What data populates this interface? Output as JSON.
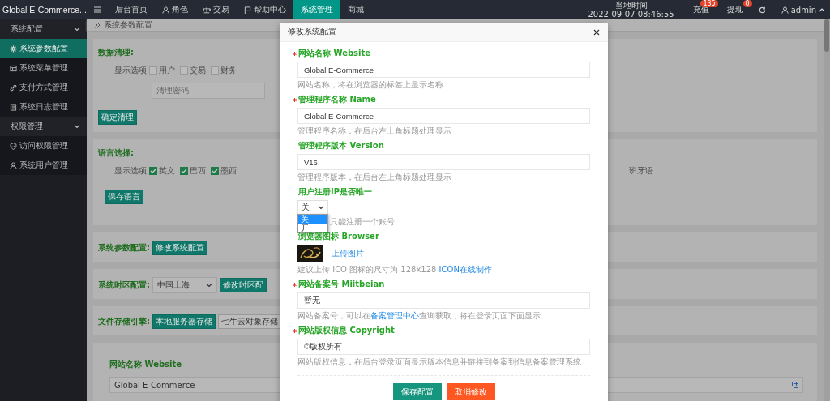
{
  "topbar": {
    "brand": "Global E-Commerce...",
    "nav": [
      {
        "label": "后台首页",
        "selected": false
      },
      {
        "label": "角色",
        "selected": false
      },
      {
        "label": "交易",
        "selected": false
      },
      {
        "label": "帮助中心",
        "selected": false
      },
      {
        "label": "系统管理",
        "selected": true
      },
      {
        "label": "商城",
        "selected": false
      }
    ],
    "time_label": "当地时间",
    "time": "2022-09-07 08:46:55",
    "actions": [
      {
        "label": "充值",
        "badge": "135"
      },
      {
        "label": "提现",
        "badge": "0"
      }
    ],
    "user": "admin"
  },
  "sidebar": [
    {
      "label": "系统配置",
      "expanded": true,
      "children": [
        {
          "label": "系统参数配置",
          "selected": true
        },
        {
          "label": "系统菜单管理",
          "selected": false
        },
        {
          "label": "支付方式管理",
          "selected": false
        },
        {
          "label": "系统日志管理",
          "selected": false
        }
      ]
    },
    {
      "label": "权限管理",
      "expanded": true,
      "children": [
        {
          "label": "访问权限管理",
          "selected": false
        },
        {
          "label": "系统用户管理",
          "selected": false
        }
      ]
    }
  ],
  "breadcrumb": "系统参数配置",
  "cleanup": {
    "title": "数据清理:",
    "options_label": "显示选项",
    "options": [
      {
        "label": "用户",
        "checked": false
      },
      {
        "label": "交易",
        "checked": false
      },
      {
        "label": "财务",
        "checked": false
      }
    ],
    "password_placeholder": "清理密码",
    "button": "确定清理"
  },
  "language": {
    "title": "语言选择:",
    "options_label": "显示选项",
    "options": [
      {
        "label": "英文",
        "checked": true
      },
      {
        "label": "巴西",
        "checked": true
      },
      {
        "label": "墨西",
        "checked": true
      }
    ],
    "partial_option": "班牙语",
    "button": "保存语言"
  },
  "params": {
    "title": "系统参数配置:",
    "button": "修改系统配置"
  },
  "timezone": {
    "title": "系统时区配置:",
    "value": "中国上海",
    "button": "修改时区配"
  },
  "storage": {
    "title": "文件存储引擎:",
    "options": [
      {
        "label": "本地服务器存储",
        "selected": true
      },
      {
        "label": "七牛云对象存储",
        "selected": false
      }
    ]
  },
  "site_card": {
    "label": "网站名称 Website",
    "value": "Global E-Commerce"
  },
  "modal": {
    "title": "修改系统配置",
    "fields": [
      {
        "kind": "text",
        "required": true,
        "label": "网站名称 Website",
        "value": "Global E-Commerce",
        "hint": [
          {
            "text": "网站名称，将在浏览器的标签上显示名称"
          }
        ]
      },
      {
        "kind": "text",
        "required": true,
        "label": "管理程序名称 Name",
        "value": "Global E-Commerce",
        "hint": [
          {
            "text": "管理程序名称，在后台左上角标题处理显示"
          }
        ]
      },
      {
        "kind": "text",
        "required": false,
        "label": "管理程序版本 Version",
        "value": "V16",
        "hint": [
          {
            "text": "管理程序版本，在后台左上角标题处理显示"
          }
        ]
      },
      {
        "kind": "select",
        "required": false,
        "label": "用户注册IP是否唯一",
        "value": "关",
        "expanded": true,
        "options": [
          {
            "label": "关",
            "selected": true
          },
          {
            "label": "开",
            "selected": false
          }
        ],
        "hint": [
          {
            "text": "只能注册一个账号"
          }
        ]
      },
      {
        "required": false,
        "label": "浏览器图标 Browser",
        "upload": "上传图片",
        "hint": [
          {
            "text": "建议上传 ICO 图标的尺寸为 128x128 "
          },
          {
            "text": "ICON在线制作",
            "link": true
          }
        ]
      },
      {
        "kind": "text",
        "required": true,
        "label": "网站备案号 Miitbeian",
        "value": "暂无",
        "hint": [
          {
            "text": "网站备案号，可以在"
          },
          {
            "text": "备案管理中心",
            "link": true
          },
          {
            "text": "查询获取，将在登录页面下面显示"
          }
        ]
      },
      {
        "kind": "text",
        "required": true,
        "label": "网站版权信息 Copyright",
        "value": "©版权所有",
        "hint": [
          {
            "text": "网站版权信息，在后台登录页面显示版本信息并链接到备案到信息备案管理系统"
          }
        ]
      }
    ],
    "buttons": [
      {
        "label": "保存配置",
        "kind": "primary"
      },
      {
        "label": "取消修改",
        "kind": "danger"
      }
    ]
  }
}
